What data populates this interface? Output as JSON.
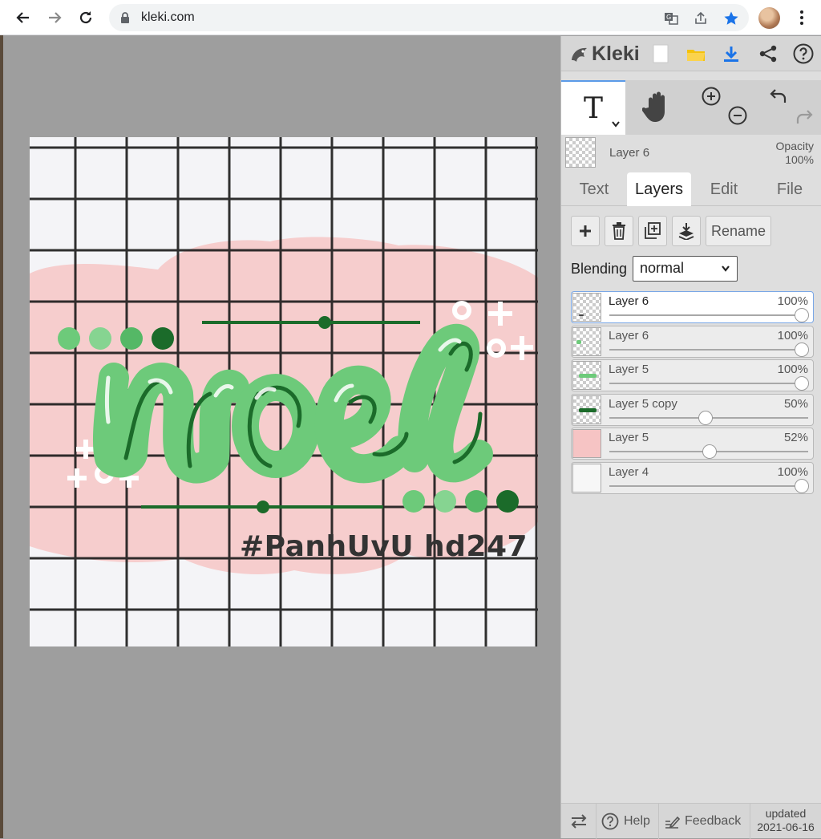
{
  "browser": {
    "url": "kleki.com",
    "icons": [
      "back-arrow-icon",
      "forward-arrow-icon",
      "reload-icon",
      "lock-icon",
      "translate-icon",
      "share-icon",
      "star-icon",
      "avatar",
      "more-icon"
    ]
  },
  "artwork": {
    "word": "noel",
    "tag_left": "#PanhUvU",
    "tag_right": "hd247",
    "colors": {
      "grid_bg": "#f4f4f7",
      "grid_line": "#1a1a1a",
      "cloud": "#f6cdcd",
      "green_light": "#6dca7a",
      "green_dark": "#1b6b2a"
    }
  },
  "app": {
    "name": "Kleki",
    "colors": {
      "panel_bg": "#dedede",
      "selected_border": "#7aa7e6",
      "accent_blue": "#1a73e8"
    }
  },
  "tools": {
    "active_tool_glyph": "T",
    "items": [
      "text-tool",
      "hand-tool",
      "zoom-in-icon",
      "zoom-out-icon",
      "undo-icon",
      "redo-icon"
    ]
  },
  "active_layer": {
    "name": "Layer 6",
    "opacity_label": "Opacity",
    "opacity_value": "100%"
  },
  "tabs": [
    {
      "label": "Text",
      "active": false
    },
    {
      "label": "Layers",
      "active": true
    },
    {
      "label": "Edit",
      "active": false
    },
    {
      "label": "File",
      "active": false
    }
  ],
  "layer_buttons": {
    "rename": "Rename"
  },
  "blending": {
    "label": "Blending",
    "value": "normal"
  },
  "layers": [
    {
      "name": "Layer 6",
      "opacity": "100%",
      "level": 1.0,
      "selected": true,
      "thumb": "checker-dark"
    },
    {
      "name": "Layer 6",
      "opacity": "100%",
      "level": 1.0,
      "selected": false,
      "thumb": "checker-green-dot"
    },
    {
      "name": "Layer 5",
      "opacity": "100%",
      "level": 1.0,
      "selected": false,
      "thumb": "checker-green-text"
    },
    {
      "name": "Layer 5 copy",
      "opacity": "50%",
      "level": 0.5,
      "selected": false,
      "thumb": "checker-dark-text"
    },
    {
      "name": "Layer 5",
      "opacity": "52%",
      "level": 0.52,
      "selected": false,
      "thumb": "pink"
    },
    {
      "name": "Layer 4",
      "opacity": "100%",
      "level": 1.0,
      "selected": false,
      "thumb": "white-grid"
    }
  ],
  "footer": {
    "help": "Help",
    "feedback": "Feedback",
    "updated_line1": "updated",
    "updated_line2": "2021-06-16"
  }
}
